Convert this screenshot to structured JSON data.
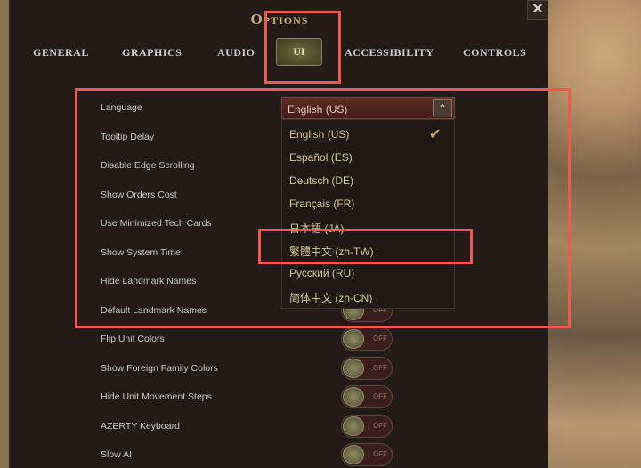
{
  "window": {
    "title": "Options",
    "close": "✕"
  },
  "tabs": [
    {
      "label": "GENERAL"
    },
    {
      "label": "GRAPHICS"
    },
    {
      "label": "AUDIO"
    },
    {
      "label": "UI",
      "active": true
    },
    {
      "label": "ACCESSIBILITY"
    },
    {
      "label": "CONTROLS"
    }
  ],
  "settings": [
    {
      "label": "Language"
    },
    {
      "label": "Tooltip Delay"
    },
    {
      "label": "Disable Edge Scrolling"
    },
    {
      "label": "Show Orders Cost"
    },
    {
      "label": "Use Minimized Tech Cards"
    },
    {
      "label": "Show System Time"
    },
    {
      "label": "Hide Landmark Names"
    },
    {
      "label": "Default Landmark Names",
      "toggle": "OFF"
    },
    {
      "label": "Flip Unit Colors",
      "toggle": "OFF"
    },
    {
      "label": "Show Foreign Family Colors",
      "toggle": "OFF"
    },
    {
      "label": "Hide Unit Movement Steps",
      "toggle": "OFF"
    },
    {
      "label": "AZERTY Keyboard",
      "toggle": "OFF"
    },
    {
      "label": "Slow AI",
      "toggle": "OFF"
    }
  ],
  "language_dropdown": {
    "selected": "English (US)",
    "arrow": "⌃",
    "options": [
      "English (US)",
      "Español (ES)",
      "Deutsch (DE)",
      "Français (FR)",
      "日本語 (JA)",
      "繁體中文 (zh-TW)",
      "Русский (RU)",
      "简体中文 (zh-CN)"
    ],
    "check": "✔"
  },
  "colors": {
    "highlight": "#f05a4e",
    "panel": "#221b17",
    "accent": "#c8b27a"
  }
}
